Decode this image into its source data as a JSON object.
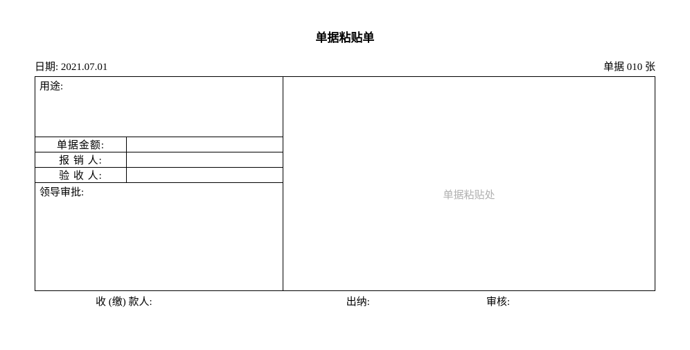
{
  "title": "单据粘贴单",
  "header": {
    "date_label": "日期:",
    "date_value": "2021.07.01",
    "count_label": "单据",
    "count_value": "010",
    "count_unit": "张"
  },
  "left": {
    "purpose_label": "用途:",
    "rows": {
      "amount_label": "单据金额:",
      "amount_value": "",
      "applicant_label": "报 销 人:",
      "applicant_value": "",
      "acceptor_label": "验 收 人:",
      "acceptor_value": ""
    },
    "approval_label": "领导审批:"
  },
  "right": {
    "paste_hint": "单据粘贴处"
  },
  "footer": {
    "payee_label": "收 (缴) 款人:",
    "cashier_label": "出纳:",
    "auditor_label": "审核:"
  }
}
